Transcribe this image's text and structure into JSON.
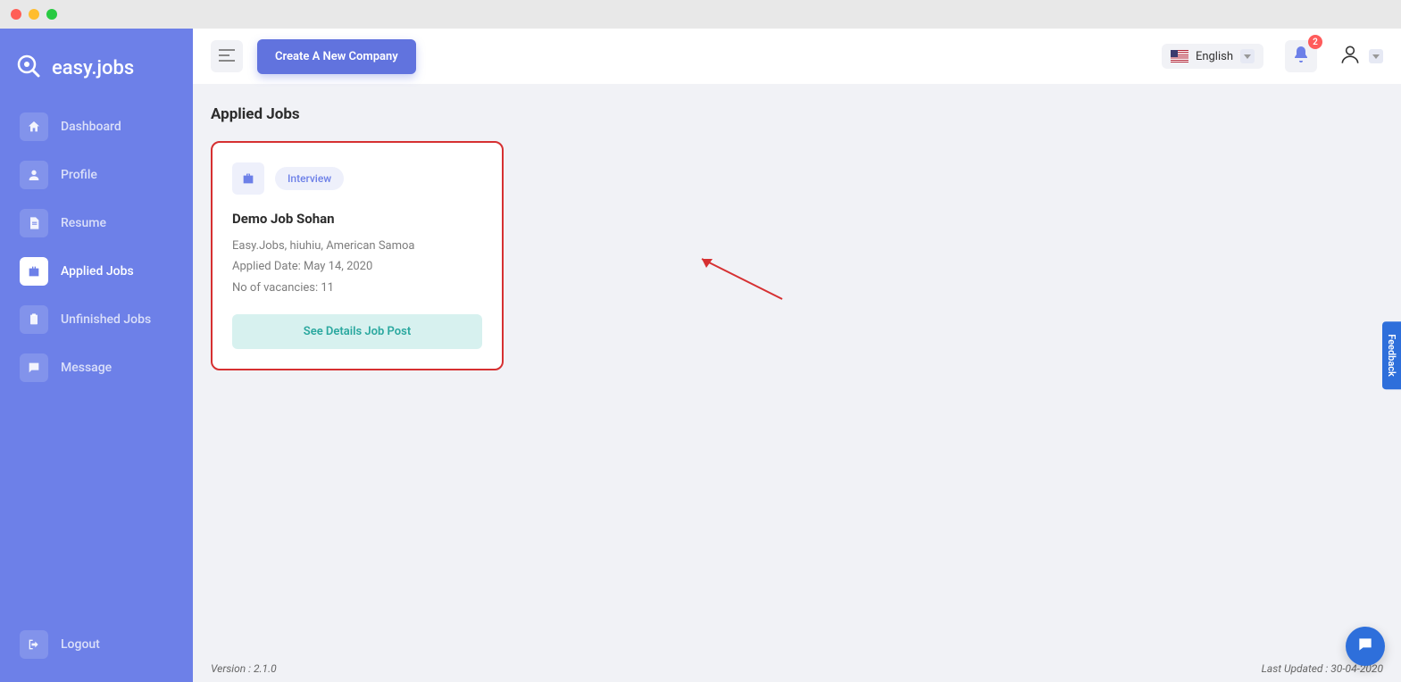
{
  "brand": {
    "name": "easy.jobs"
  },
  "sidebar": {
    "items": [
      {
        "label": "Dashboard"
      },
      {
        "label": "Profile"
      },
      {
        "label": "Resume"
      },
      {
        "label": "Applied Jobs"
      },
      {
        "label": "Unfinished Jobs"
      },
      {
        "label": "Message"
      }
    ],
    "logout_label": "Logout"
  },
  "topbar": {
    "create_company_label": "Create A New Company",
    "language_label": "English",
    "notification_count": "2"
  },
  "page": {
    "title": "Applied Jobs"
  },
  "job_card": {
    "status": "Interview",
    "title": "Demo Job Sohan",
    "company_location": "Easy.Jobs, hiuhiu, American Samoa",
    "applied_date": "Applied Date: May 14, 2020",
    "vacancies": "No of vacancies: 11",
    "details_label": "See Details Job Post"
  },
  "footer": {
    "version": "Version : 2.1.0",
    "last_updated": "Last Updated : 30-04-2020"
  },
  "feedback": {
    "label": "Feedback"
  }
}
